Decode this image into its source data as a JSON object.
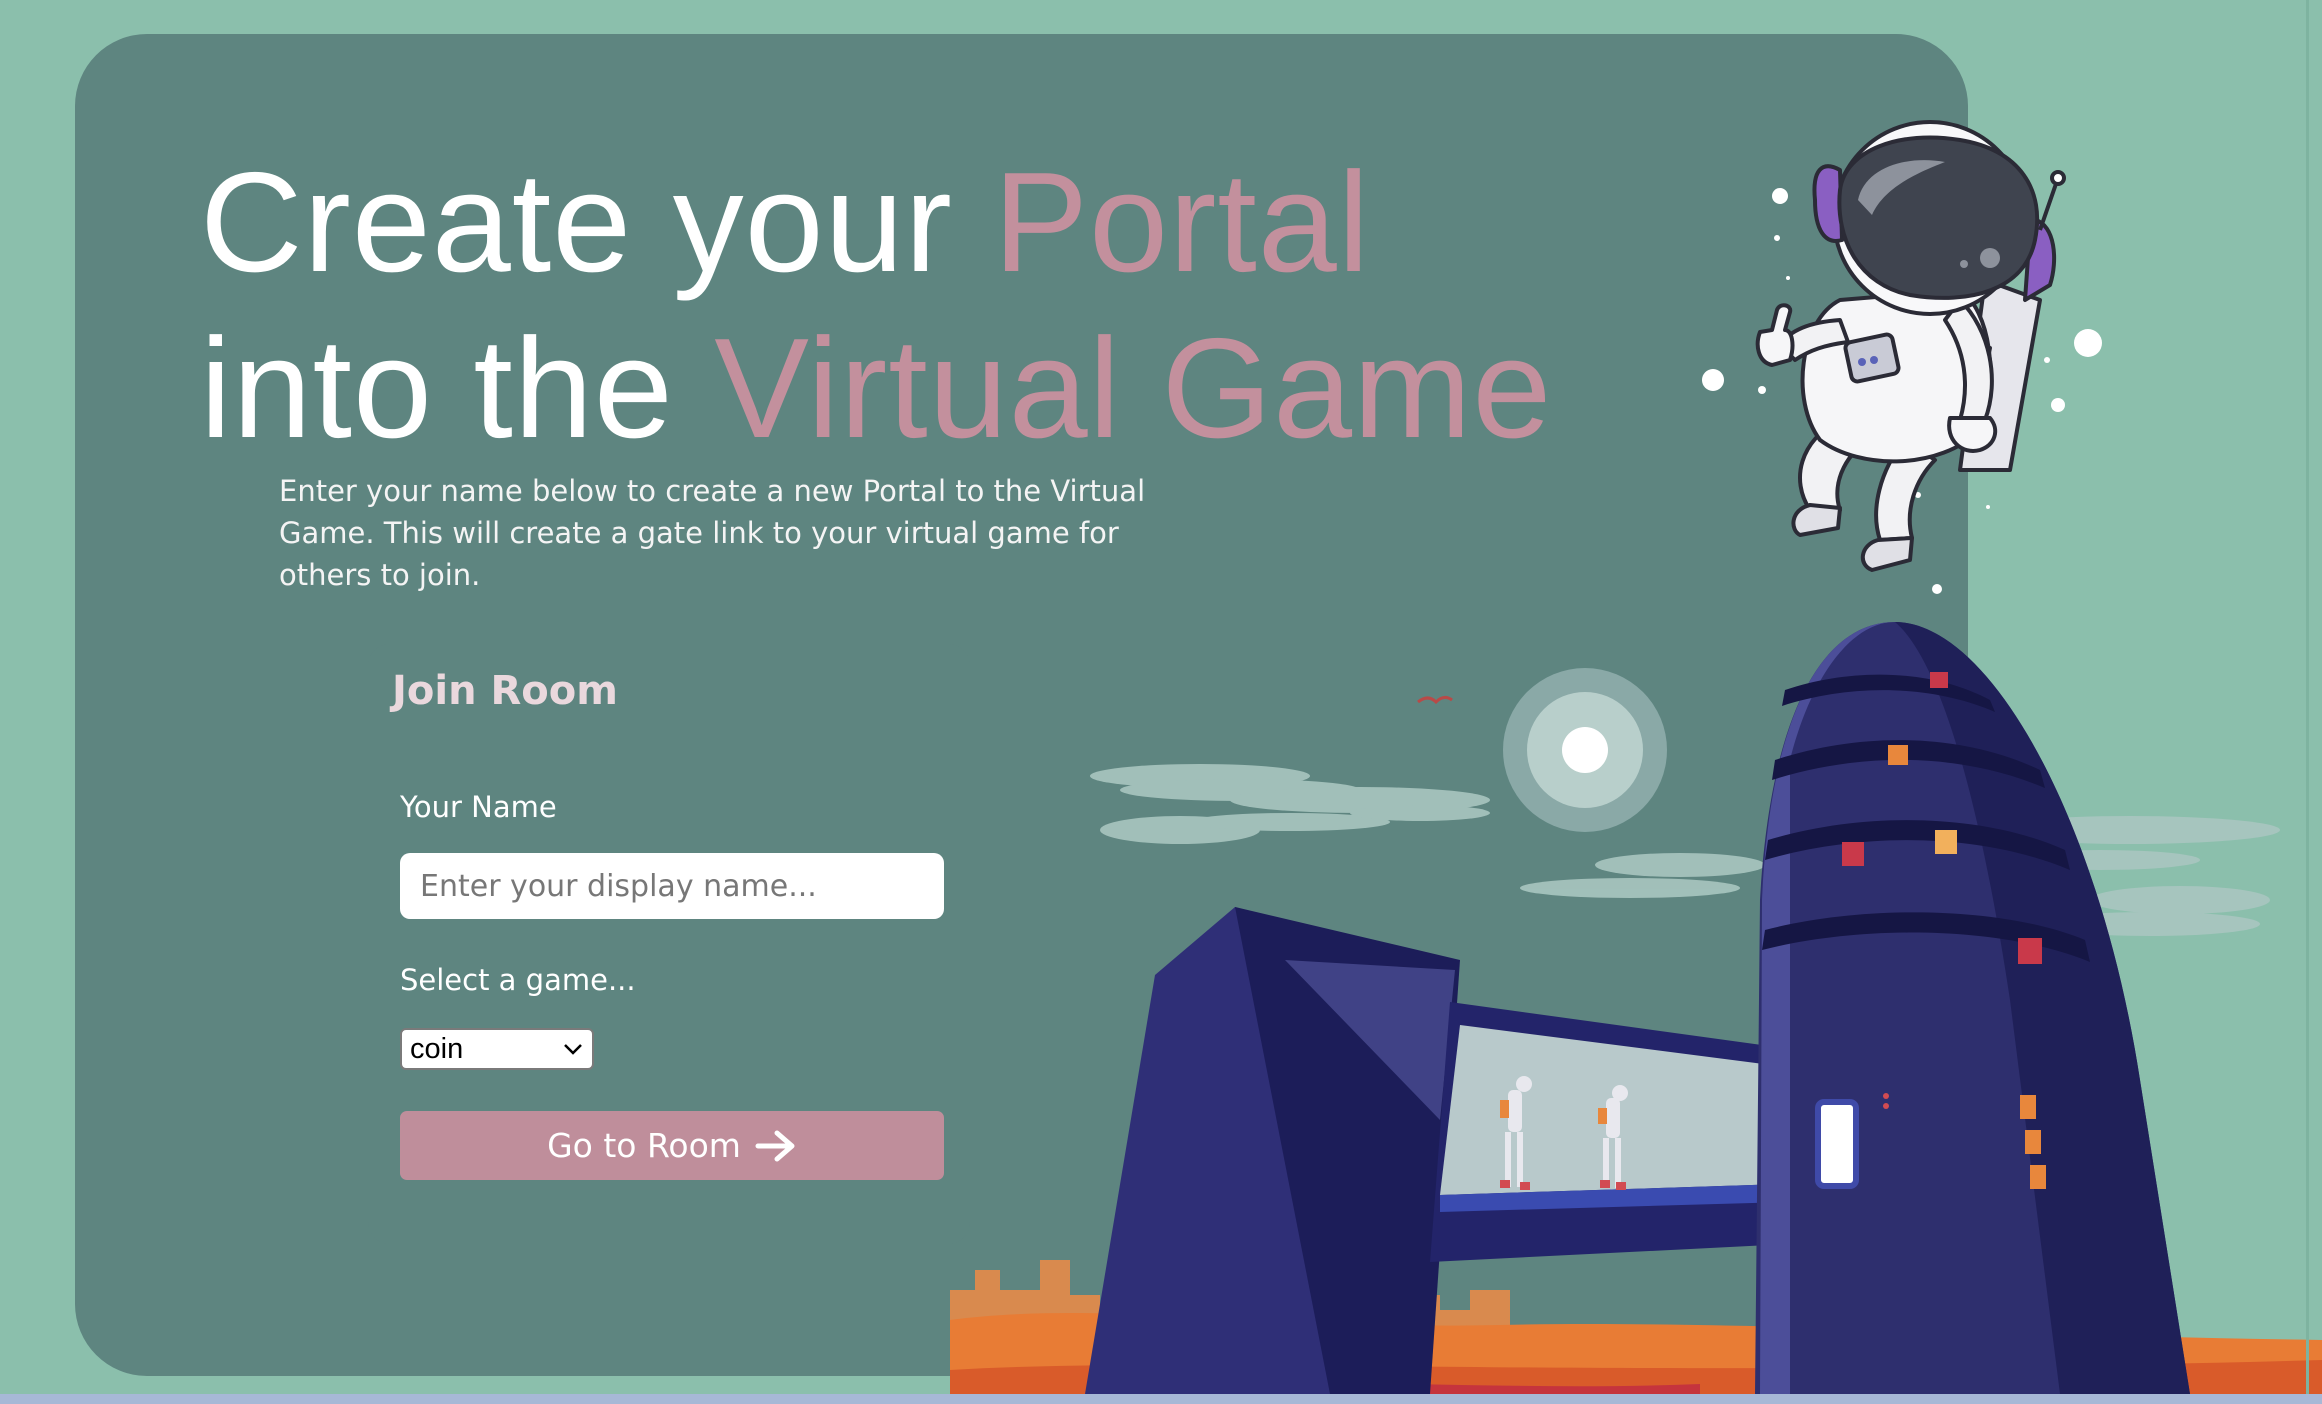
{
  "hero": {
    "title_line1_plain": "Create your ",
    "title_line1_accent": "Portal",
    "title_line2_plain": "into the ",
    "title_line2_accent": "Virtual Game",
    "description": "Enter your name below to create a new Portal to the Virtual Game. This will create a gate link to your virtual game for others to join."
  },
  "join_form": {
    "heading": "Join Room",
    "name_label": "Your Name",
    "name_placeholder": "Enter your display name...",
    "name_value": "",
    "game_label": "Select a game...",
    "game_selected": "coin",
    "submit_label": "Go to Room"
  },
  "icons": {
    "submit_icon": "arrow-right-icon",
    "select_icon": "chevron-down-icon"
  },
  "colors": {
    "page_background": "#8bbfac",
    "card_background": "#5e8580",
    "accent": "#c3909d",
    "button": "#bf8e9b",
    "rocket": "#2e2f6e"
  }
}
